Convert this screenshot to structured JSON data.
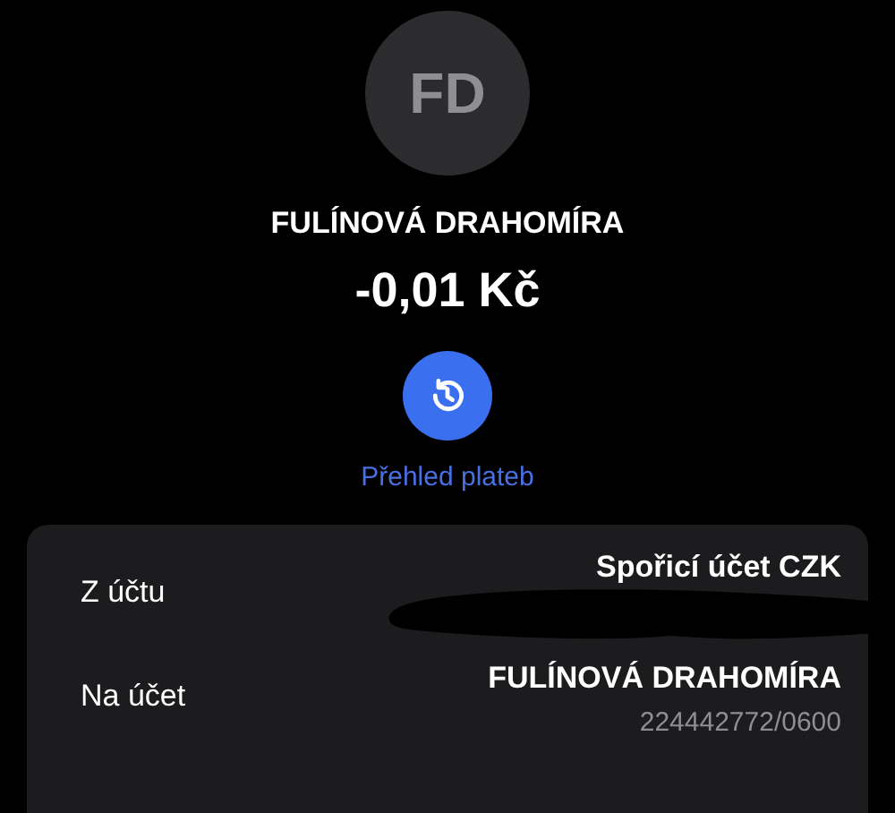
{
  "avatar": {
    "initials": "FD"
  },
  "name": "FULÍNOVÁ DRAHOMÍRA",
  "amount": "-0,01 Kč",
  "history": {
    "label": "Přehled plateb"
  },
  "details": [
    {
      "label": "Z účtu",
      "value": "Spořicí účet CZK",
      "redacted": true
    },
    {
      "label": "Na účet",
      "value": "FULÍNOVÁ DRAHOMÍRA",
      "sub": "224442772/0600",
      "redacted": false
    }
  ]
}
